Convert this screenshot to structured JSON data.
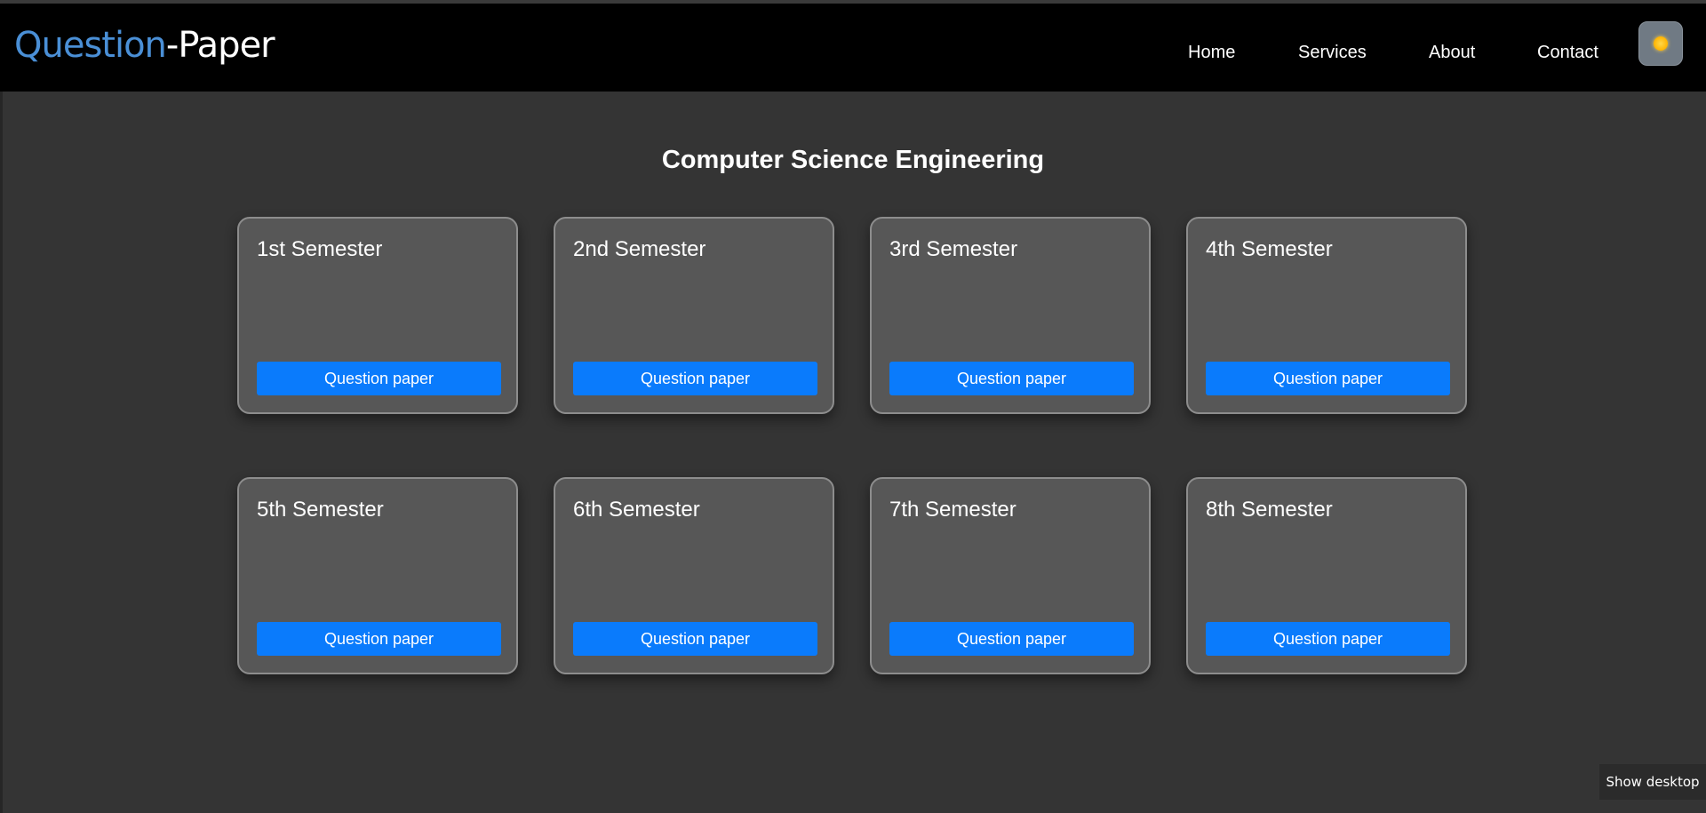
{
  "brand": {
    "part1": "Question",
    "part2": "-Paper"
  },
  "nav": {
    "home": "Home",
    "services": "Services",
    "about": "About",
    "contact": "Contact"
  },
  "theme_toggle": {
    "icon": "sun-icon"
  },
  "page_title": "Computer Science Engineering",
  "cards": [
    {
      "title": "1st Semester",
      "button": "Question paper"
    },
    {
      "title": "2nd Semester",
      "button": "Question paper"
    },
    {
      "title": "3rd Semester",
      "button": "Question paper"
    },
    {
      "title": "4th Semester",
      "button": "Question paper"
    },
    {
      "title": "5th Semester",
      "button": "Question paper"
    },
    {
      "title": "6th Semester",
      "button": "Question paper"
    },
    {
      "title": "7th Semester",
      "button": "Question paper"
    },
    {
      "title": "8th Semester",
      "button": "Question paper"
    }
  ],
  "taskbar": {
    "show_desktop": "Show desktop"
  },
  "colors": {
    "background": "#343434",
    "navbar": "#000000",
    "brand_accent": "#4a8fd6",
    "card_background": "#575757",
    "card_border": "#8d8d8d",
    "button": "#0a7bfc"
  }
}
